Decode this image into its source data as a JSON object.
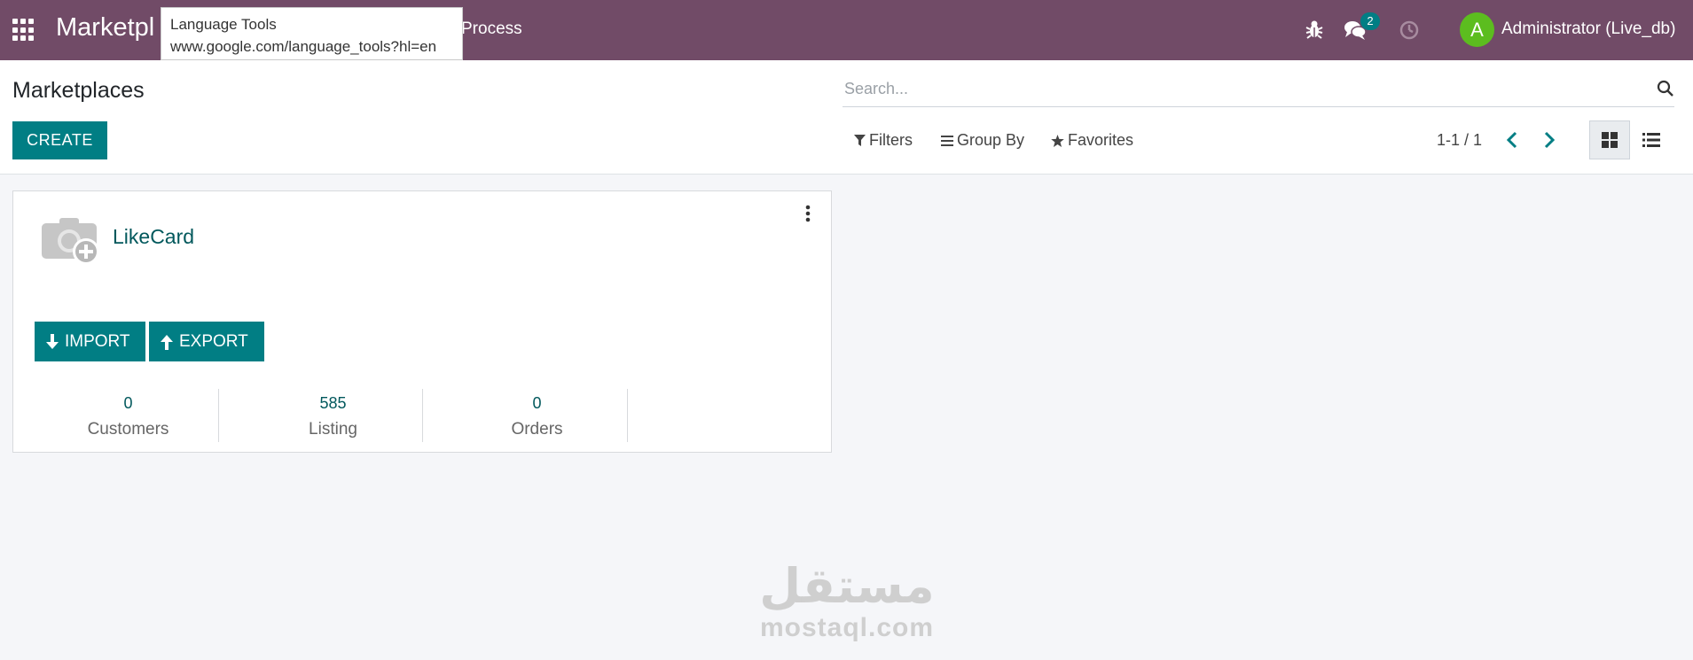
{
  "navbar": {
    "brand": "Marketpl",
    "menu_item": "Process",
    "notification_count": "2",
    "user_initial": "A",
    "user_name": "Administrator (Live_db)"
  },
  "tooltip": {
    "title": "Language Tools",
    "url": "www.google.com/language_tools?hl=en"
  },
  "control_panel": {
    "title": "Marketplaces",
    "create_label": "CREATE",
    "search_placeholder": "Search...",
    "filters_label": "Filters",
    "group_by_label": "Group By",
    "favorites_label": "Favorites",
    "pager": "1-1 / 1"
  },
  "card": {
    "title": "LikeCard",
    "import_label": "IMPORT",
    "export_label": "EXPORT",
    "stats": [
      {
        "value": "0",
        "label": "Customers"
      },
      {
        "value": "585",
        "label": "Listing"
      },
      {
        "value": "0",
        "label": "Orders"
      }
    ]
  },
  "watermark": {
    "arabic": "مستقل",
    "latin": "mostaql.com"
  },
  "colors": {
    "navbar": "#714b67",
    "primary": "#017e84",
    "link": "#01585c"
  }
}
